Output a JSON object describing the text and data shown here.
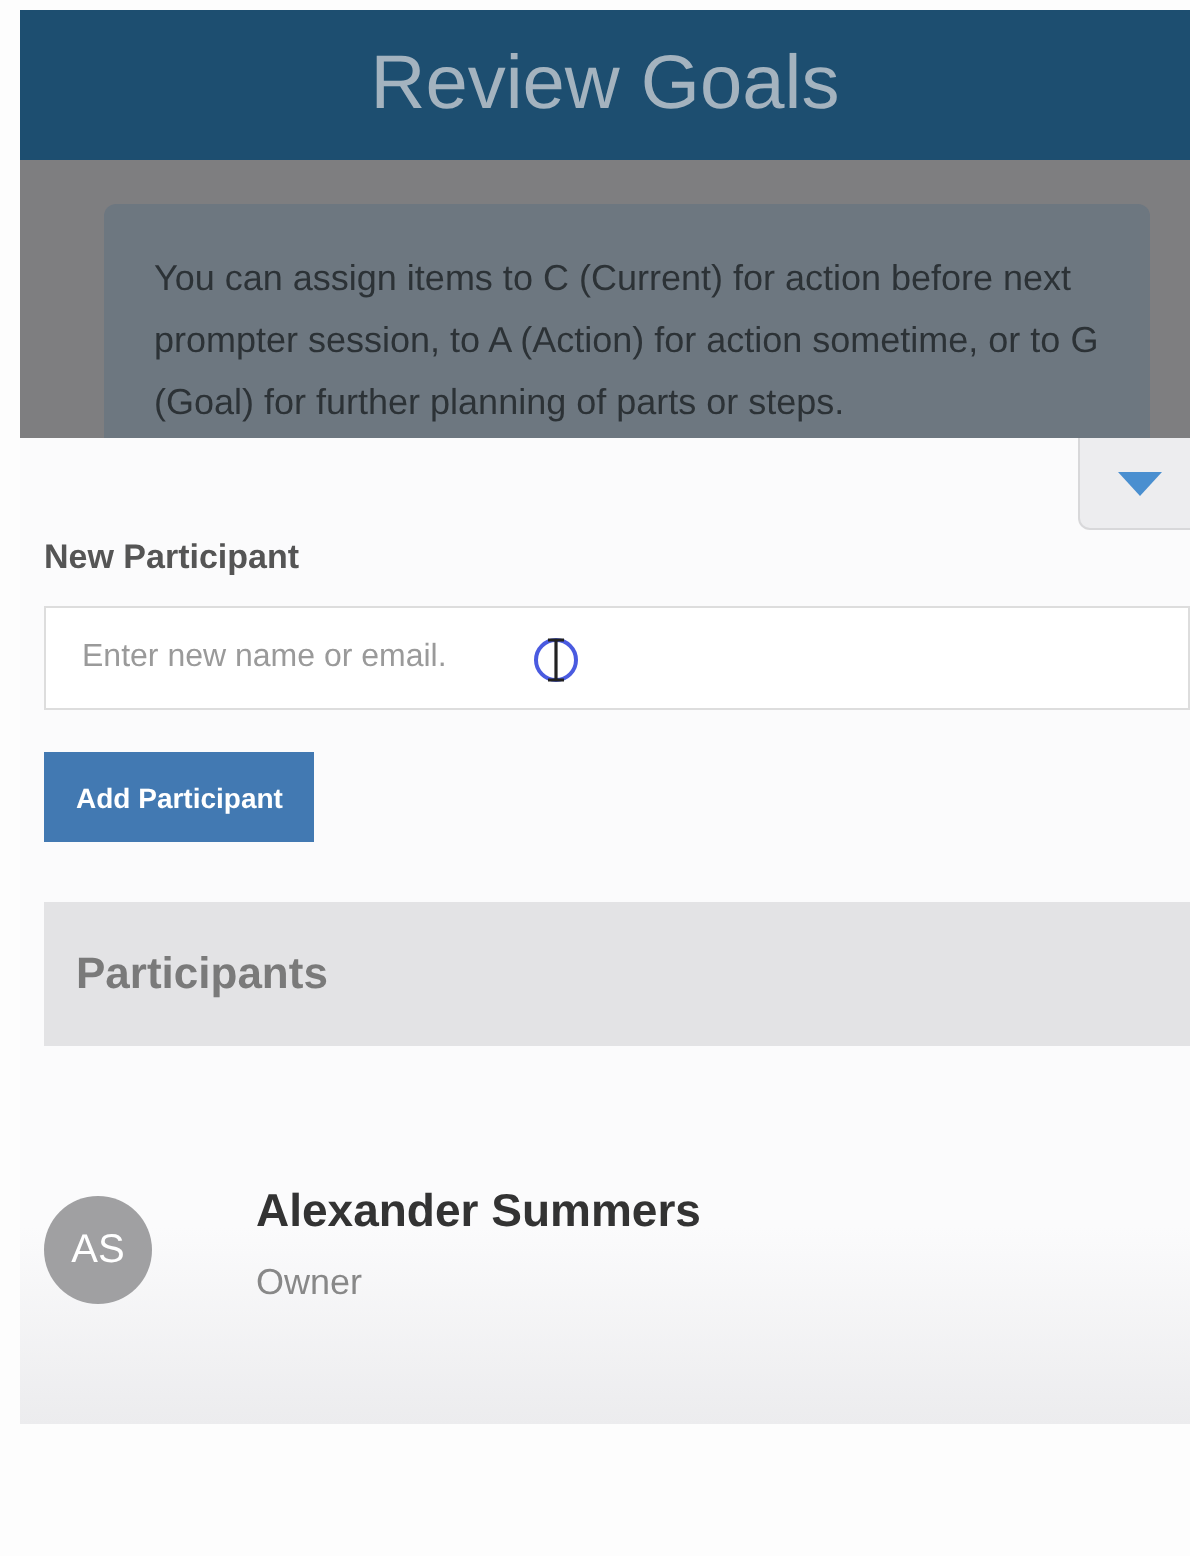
{
  "header": {
    "title": "Review Goals"
  },
  "info": {
    "text": "You can assign items to C (Current) for action before next prompter session, to A (Action) for action sometime, or to G (Goal) for further planning of parts or steps."
  },
  "new_participant": {
    "label": "New Participant",
    "placeholder": "Enter new name or email.",
    "button": "Add Participant"
  },
  "participants": {
    "heading": "Participants",
    "items": [
      {
        "initials": "AS",
        "name": "Alexander Summers",
        "role": "Owner"
      }
    ]
  }
}
